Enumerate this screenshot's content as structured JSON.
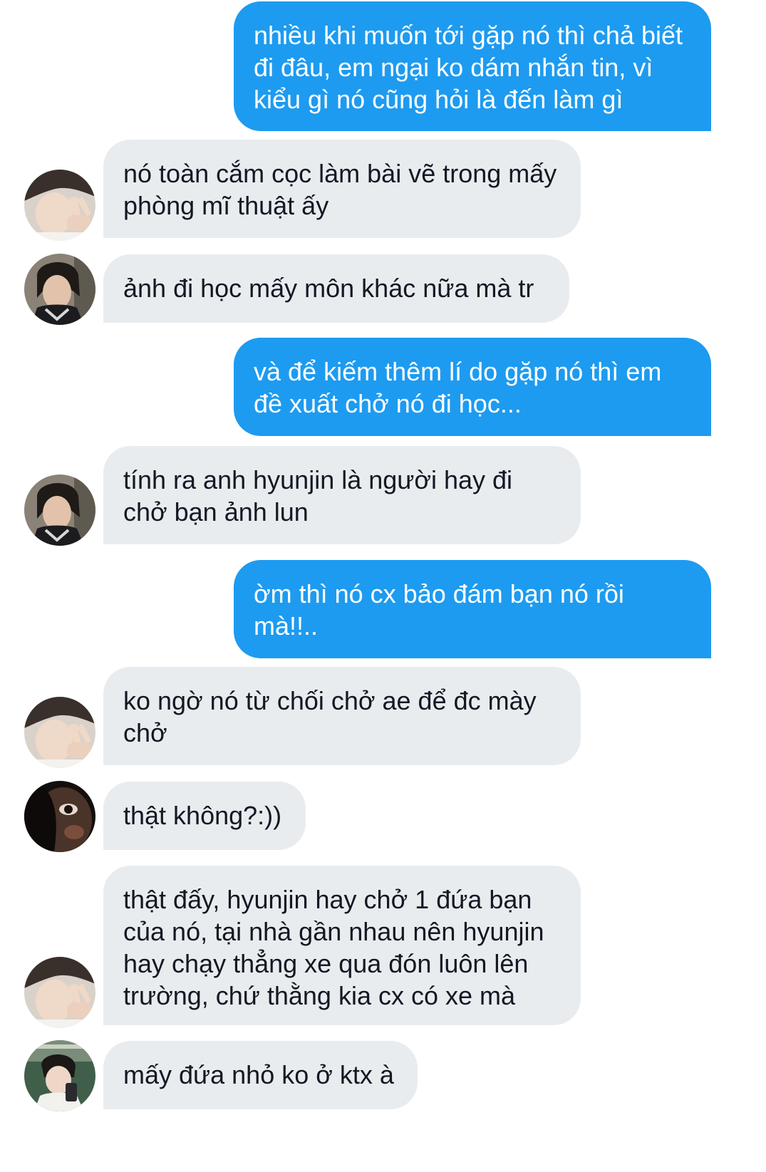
{
  "messages": [
    {
      "side": "out",
      "text": "nhiều khi muốn tới gặp nó thì chả biết đi đâu, em ngại ko dám nhắn tin, vì kiểu gì nó cũng hỏi là đến làm gì"
    },
    {
      "side": "in",
      "avatar": "peace-sign-avatar",
      "text": "nó toàn cắm cọc làm bài vẽ trong mấy phòng mĩ thuật ấy"
    },
    {
      "side": "in",
      "avatar": "dark-hair-avatar",
      "text": "ảnh đi học mấy môn khác nữa mà tr"
    },
    {
      "side": "out",
      "text": "và để kiếm thêm lí do gặp nó thì em đề xuất chở nó đi học..."
    },
    {
      "side": "in",
      "avatar": "dark-hair-avatar",
      "text": "tính ra anh hyunjin là người hay đi chở bạn ảnh lun"
    },
    {
      "side": "out",
      "text": "ờm thì nó cx bảo đám bạn nó rồi mà!!.."
    },
    {
      "side": "in",
      "avatar": "peace-sign-avatar",
      "text": "ko ngờ nó từ chối chở ae để đc mày chở"
    },
    {
      "side": "in",
      "avatar": "closeup-eye-avatar",
      "text": "thật không?:))"
    },
    {
      "side": "in",
      "avatar": "peace-sign-avatar",
      "text": "thật đấy, hyunjin hay chở 1 đứa bạn của nó, tại nhà gần nhau nên hyunjin hay chạy thẳng xe qua đón luôn lên trường, chứ thằng kia cx có xe mà"
    },
    {
      "side": "in",
      "avatar": "phone-selfie-avatar",
      "text": "mấy đứa nhỏ ko ở ktx à"
    }
  ],
  "colors": {
    "outgoing_bubble": "#1d9bf0",
    "incoming_bubble": "#e9ecef",
    "incoming_text": "#141823",
    "outgoing_text": "#ffffff"
  }
}
